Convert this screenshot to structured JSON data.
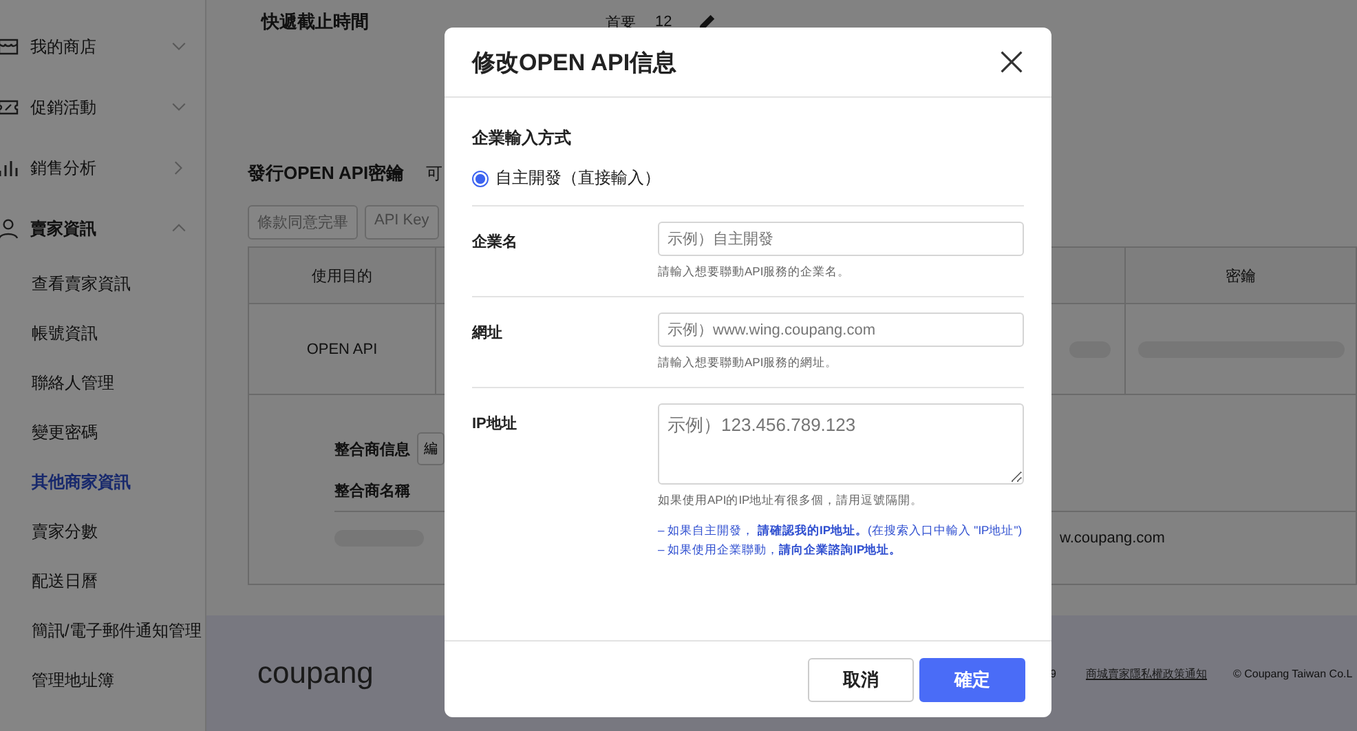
{
  "sidebar": {
    "items": [
      {
        "label": "我的商店",
        "expanded": false
      },
      {
        "label": "促銷活動",
        "expanded": false
      },
      {
        "label": "銷售分析",
        "expanded": false
      },
      {
        "label": "賣家資訊",
        "expanded": true,
        "children": [
          {
            "label": "查看賣家資訊",
            "selected": false
          },
          {
            "label": "帳號資訊",
            "selected": false
          },
          {
            "label": "聯絡人管理",
            "selected": false
          },
          {
            "label": "變更密碼",
            "selected": false
          },
          {
            "label": "其他商家資訊",
            "selected": true
          },
          {
            "label": "賣家分數",
            "selected": false
          },
          {
            "label": "配送日曆",
            "selected": false
          },
          {
            "label": "簡訊/電子郵件通知管理",
            "selected": false
          },
          {
            "label": "管理地址簿",
            "selected": false
          }
        ]
      }
    ]
  },
  "main": {
    "cutoff": {
      "title": "快遞截止時間",
      "label": "首要",
      "value": "12"
    },
    "api_section": {
      "title": "發行OPEN API密鑰",
      "note": "可",
      "steps": [
        "條款同意完畢",
        "API Key"
      ],
      "table": {
        "columns": [
          "使用目的",
          "密鑰"
        ],
        "rows": [
          {
            "purpose": "OPEN API"
          }
        ]
      },
      "integrator": {
        "info_label": "整合商信息",
        "edit_button": "編",
        "name_label": "整合商名稱",
        "url": "w.coupang.com"
      }
    },
    "footer": {
      "logo": "coupang",
      "number": "9",
      "privacy_link": "商城賣家隱私權政策通知",
      "copyright": "© Coupang Taiwan Co.L"
    }
  },
  "modal": {
    "title": "修改OPEN API信息",
    "method": {
      "heading": "企業輸入方式",
      "options": [
        {
          "label": "自主開發（直接輸入）",
          "selected": true
        }
      ]
    },
    "fields": [
      {
        "kind": "input",
        "label": "企業名",
        "placeholder": "示例）自主開發",
        "hint": "請輸入想要聯動API服務的企業名。"
      },
      {
        "kind": "input",
        "label": "網址",
        "placeholder": "示例）www.wing.coupang.com",
        "hint": "請輸入想要聯動API服務的網址。"
      },
      {
        "kind": "textarea",
        "label": "IP地址",
        "placeholder": "示例）123.456.789.123",
        "hint": "如果使用API的IP地址有很多個，請用逗號隔開。",
        "notes": [
          "– 如果自主開發， **請確認我的IP地址。**(在搜索入口中輸入 \"IP地址\")",
          "– 如果使用企業聯動，**請向企業諮詢IP地址。**"
        ]
      }
    ],
    "buttons": [
      {
        "label": "取消",
        "kind": "secondary"
      },
      {
        "label": "確定",
        "kind": "primary"
      }
    ]
  }
}
